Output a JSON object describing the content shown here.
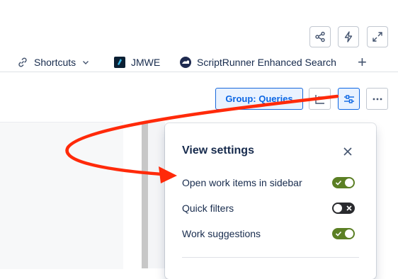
{
  "nav": {
    "shortcuts_label": "Shortcuts",
    "jmwe_label": "JMWE",
    "scriptrunner_label": "ScriptRunner Enhanced Search",
    "add_label": "+"
  },
  "toolbar": {
    "group_label": "Group: Queries"
  },
  "view_settings": {
    "title": "View settings",
    "items": [
      {
        "label": "Open work items in sidebar",
        "enabled": true
      },
      {
        "label": "Quick filters",
        "enabled": false
      },
      {
        "label": "Work suggestions",
        "enabled": true
      }
    ]
  },
  "colors": {
    "toggle_on": "#5b7f24",
    "toggle_off": "#292a2e",
    "accent": "#0c66e4",
    "annotation_arrow": "#ff2a0a"
  }
}
